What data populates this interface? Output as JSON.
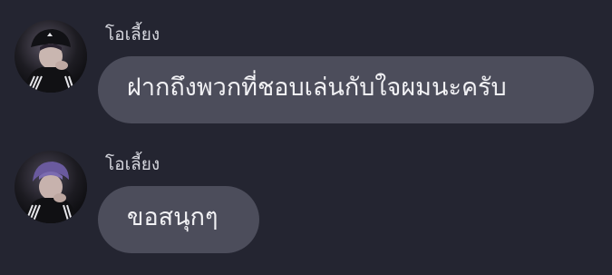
{
  "messages": [
    {
      "sender": "โอเลี้ยง",
      "text": "ฝากถึงพวกที่ชอบเล่นกับใจผมนะครับ",
      "avatar_icon": "user-avatar-photo"
    },
    {
      "sender": "โอเลี้ยง",
      "text": "ขอสนุกๆ",
      "avatar_icon": "user-avatar-photo"
    }
  ],
  "colors": {
    "background": "#242531",
    "bubble": "#4c4d5b",
    "sender_text": "#d6d7de",
    "message_text": "#f1f1f4"
  }
}
